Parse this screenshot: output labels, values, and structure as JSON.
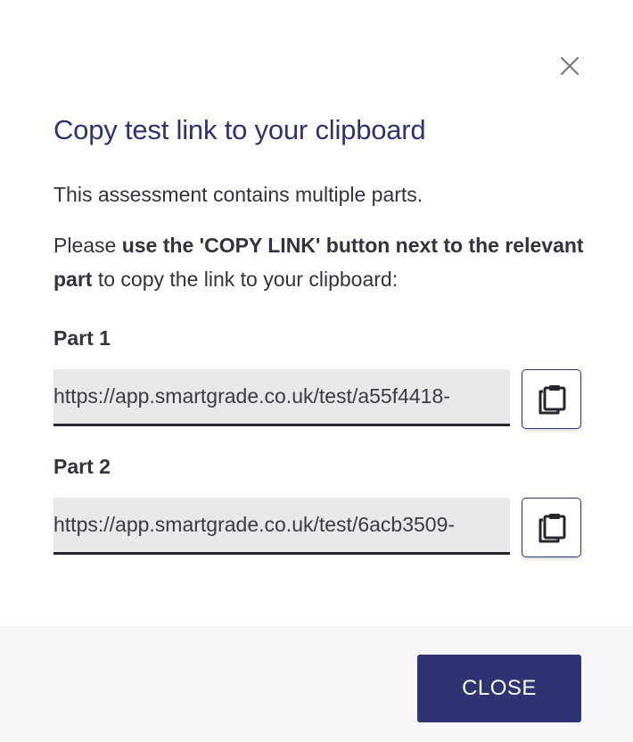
{
  "dialog": {
    "title": "Copy test link to your clipboard",
    "intro": "This assessment contains multiple parts.",
    "instruction": {
      "prefix": "Please ",
      "emphasis": "use the 'COPY LINK' button next to the relevant part",
      "suffix": " to copy the link to your clipboard:"
    },
    "close_icon": "close-icon"
  },
  "parts": [
    {
      "label": "Part 1",
      "link": "https://app.smartgrade.co.uk/test/a55f4418-",
      "copy_icon": "clipboard-icon"
    },
    {
      "label": "Part 2",
      "link": "https://app.smartgrade.co.uk/test/6acb3509-",
      "copy_icon": "clipboard-icon"
    }
  ],
  "footer": {
    "close_label": "CLOSE"
  },
  "colors": {
    "primary": "#2e3472",
    "text": "#333340",
    "field_bg": "#e8e8e8",
    "footer_bg": "#f6f7f9"
  }
}
